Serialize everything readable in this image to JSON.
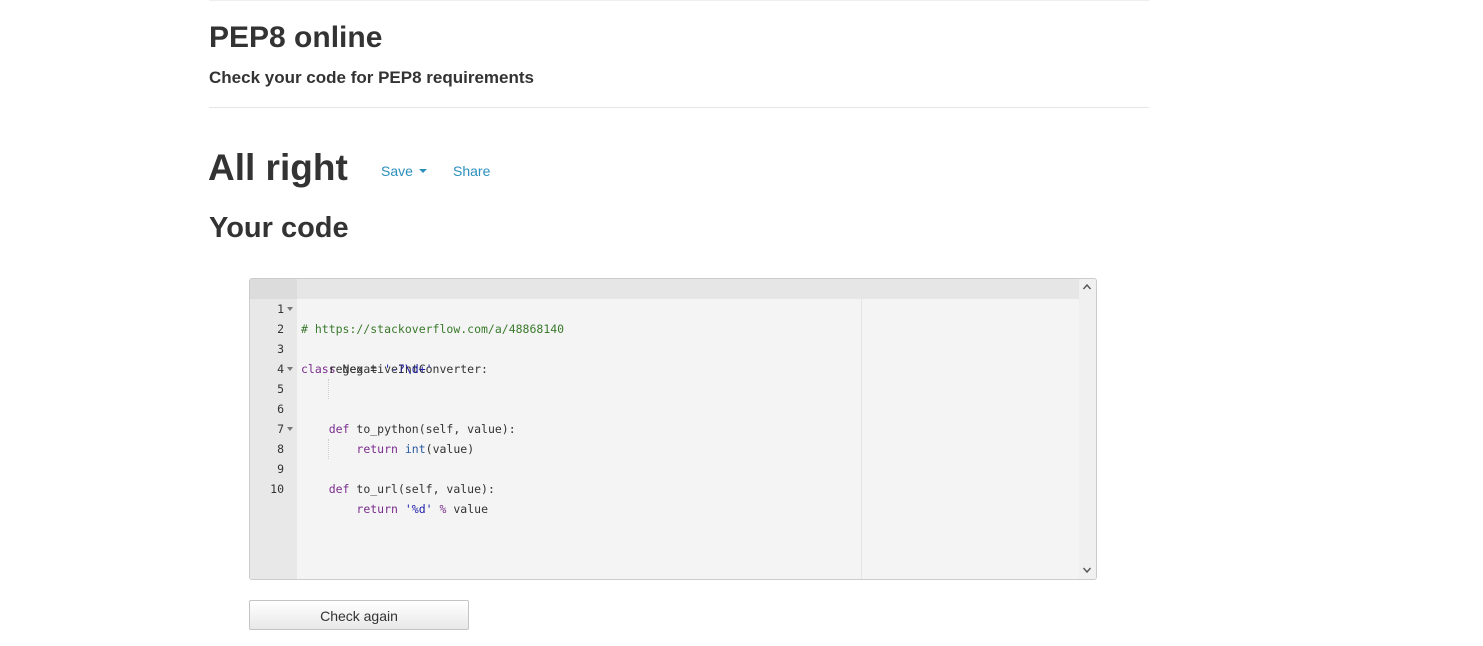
{
  "header": {
    "title": "PEP8 online",
    "subtitle": "Check your code for PEP8 requirements"
  },
  "result": {
    "heading": "All right",
    "save_label": "Save",
    "share_label": "Share"
  },
  "code_section": {
    "heading": "Your code"
  },
  "editor": {
    "lines": [
      {
        "n": "1",
        "text": "# https://stackoverflow.com/a/48868140"
      },
      {
        "n": "2",
        "text": "class NegativeIntConverter:"
      },
      {
        "n": "3",
        "text": "    regex = '-?\\d+'"
      },
      {
        "n": "4",
        "text": ""
      },
      {
        "n": "5",
        "text": "    def to_python(self, value):"
      },
      {
        "n": "6",
        "text": "        return int(value)"
      },
      {
        "n": "7",
        "text": ""
      },
      {
        "n": "8",
        "text": "    def to_url(self, value):"
      },
      {
        "n": "9",
        "text": "        return '%d' % value"
      },
      {
        "n": "10",
        "text": ""
      }
    ],
    "fold_lines": [
      "2",
      "5",
      "8"
    ]
  },
  "actions": {
    "check_again_label": "Check again"
  },
  "colors": {
    "link": "#2a8fbd",
    "comment": "#3a7a2c",
    "keyword": "#7a2d8c",
    "string": "#1a1aa6",
    "builtin": "#2a5d9e"
  }
}
